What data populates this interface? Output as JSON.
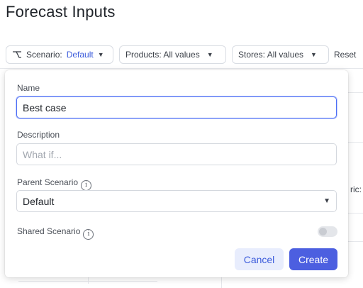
{
  "page": {
    "title": "Forecast Inputs"
  },
  "filters": {
    "scenario": {
      "label": "Scenario:",
      "value": "Default"
    },
    "products": {
      "label": "Products: All values"
    },
    "stores": {
      "label": "Stores: All values"
    },
    "reset": "Reset"
  },
  "background": {
    "partial_text": "ric:"
  },
  "form": {
    "name": {
      "label": "Name",
      "value": "Best case"
    },
    "description": {
      "label": "Description",
      "placeholder": "What if..."
    },
    "parent": {
      "label": "Parent Scenario",
      "value": "Default"
    },
    "shared": {
      "label": "Shared Scenario",
      "enabled": false
    },
    "cancel_label": "Cancel",
    "create_label": "Create"
  },
  "colors": {
    "accent": "#4c5fe0",
    "link": "#3b5bdb"
  },
  "icons": {
    "scenario": "branch-icon",
    "info": "info-icon",
    "caret": "caret-down-icon"
  }
}
